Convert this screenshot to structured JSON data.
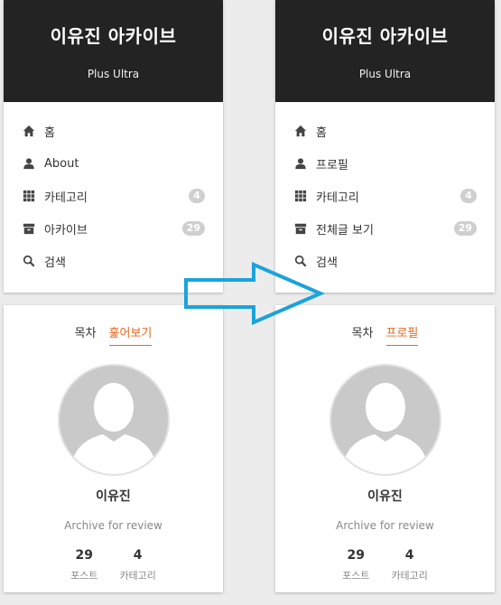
{
  "before": {
    "blog_title": "이유진 아카이브",
    "subtitle": "Plus Ultra",
    "menu": [
      {
        "label": "홈",
        "icon": "home-icon"
      },
      {
        "label": "About",
        "icon": "user-icon"
      },
      {
        "label": "카테고리",
        "icon": "grid-icon",
        "count": "4"
      },
      {
        "label": "아카이브",
        "icon": "archive-icon",
        "count": "29"
      },
      {
        "label": "검색",
        "icon": "search-icon"
      }
    ],
    "tabs": [
      "목차",
      "훑어보기"
    ],
    "active_tab": 1,
    "profile_name": "이유진",
    "profile_desc": "Archive for review",
    "stats": [
      {
        "value": "29",
        "label": "포스트"
      },
      {
        "value": "4",
        "label": "카테고리"
      }
    ]
  },
  "after": {
    "blog_title": "이유진 아카이브",
    "subtitle": "Plus Ultra",
    "menu": [
      {
        "label": "홈",
        "icon": "home-icon"
      },
      {
        "label": "프로필",
        "icon": "user-icon"
      },
      {
        "label": "카테고리",
        "icon": "grid-icon",
        "count": "4"
      },
      {
        "label": "전체글 보기",
        "icon": "archive-icon",
        "count": "29"
      },
      {
        "label": "검색",
        "icon": "search-icon"
      }
    ],
    "tabs": [
      "목차",
      "프로필"
    ],
    "active_tab": 1,
    "profile_name": "이유진",
    "profile_desc": "Archive for review",
    "stats": [
      {
        "value": "29",
        "label": "포스트"
      },
      {
        "value": "4",
        "label": "카테고리"
      }
    ]
  },
  "colors": {
    "header_bg": "#232323",
    "accent": "#e8661d",
    "arrow": "#1aa3dc",
    "badge": "#cfcfcf"
  },
  "arrow_icon": "right-arrow-icon"
}
